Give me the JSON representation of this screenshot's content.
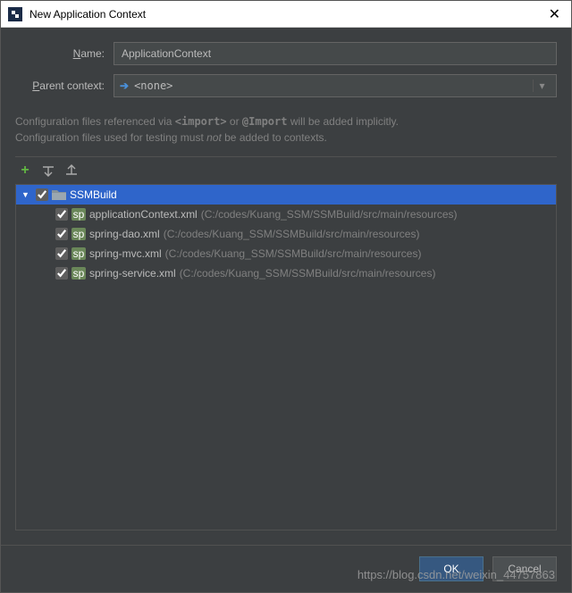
{
  "window": {
    "title": "New Application Context"
  },
  "form": {
    "name_label": "Name:",
    "name_value": "ApplicationContext",
    "parent_label": "Parent context:",
    "parent_value": "<none>"
  },
  "info": {
    "line1_a": "Configuration files referenced via ",
    "line1_import1": "<import>",
    "line1_b": " or ",
    "line1_import2": "@Import",
    "line1_c": " will be added implicitly.",
    "line2_a": "Configuration files used for testing must ",
    "line2_not": "not",
    "line2_b": " be added to contexts."
  },
  "tree": {
    "root": {
      "label": "SSMBuild",
      "checked": true,
      "expanded": true
    },
    "children": [
      {
        "label": "applicationContext.xml",
        "path": "(C:/codes/Kuang_SSM/SSMBuild/src/main/resources)",
        "checked": true
      },
      {
        "label": "spring-dao.xml",
        "path": "(C:/codes/Kuang_SSM/SSMBuild/src/main/resources)",
        "checked": true
      },
      {
        "label": "spring-mvc.xml",
        "path": "(C:/codes/Kuang_SSM/SSMBuild/src/main/resources)",
        "checked": true
      },
      {
        "label": "spring-service.xml",
        "path": "(C:/codes/Kuang_SSM/SSMBuild/src/main/resources)",
        "checked": true
      }
    ]
  },
  "buttons": {
    "ok": "OK",
    "cancel": "Cancel"
  },
  "watermark": "https://blog.csdn.net/weixin_44757863"
}
